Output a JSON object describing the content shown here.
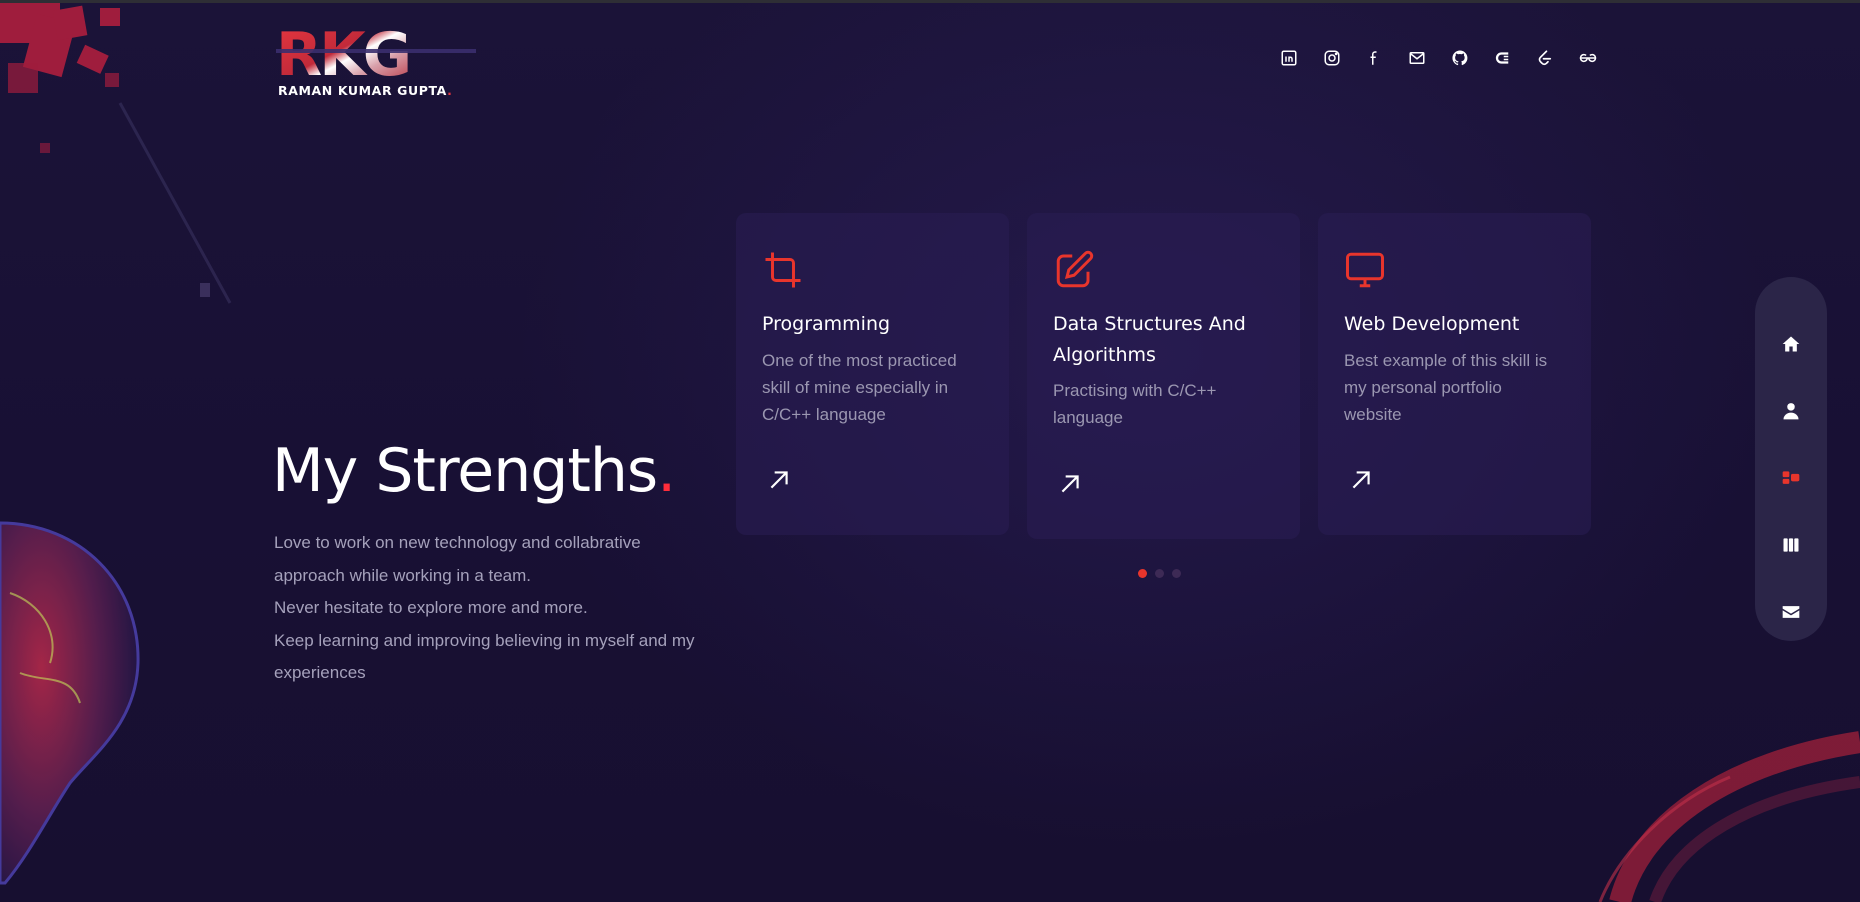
{
  "logo": {
    "mark_text": "RKG",
    "subtitle": "RAMAN KUMAR GUPTA",
    "subtitle_dot": "."
  },
  "social": [
    {
      "name": "linkedin-icon"
    },
    {
      "name": "instagram-icon"
    },
    {
      "name": "facebook-icon"
    },
    {
      "name": "mail-icon"
    },
    {
      "name": "github-icon"
    },
    {
      "name": "codechef-icon"
    },
    {
      "name": "leetcode-icon"
    },
    {
      "name": "geeksforgeeks-icon"
    }
  ],
  "hero": {
    "heading": "My Strengths",
    "heading_dot": ".",
    "lines": [
      "Love to work on new technology and collabrative approach while working in a team.",
      "Never hesitate to explore more and more.",
      "Keep learning and improving believing in myself and my experiences"
    ]
  },
  "cards": [
    {
      "icon": "crop-icon",
      "title": "Programming",
      "description": "One of the most practiced skill of mine especially in C/C++ language"
    },
    {
      "icon": "edit-icon",
      "title": "Data Structures And Algorithms",
      "description": "Practising with C/C++ language"
    },
    {
      "icon": "monitor-icon",
      "title": "Web Development",
      "description": "Best example of this skill is my personal portfolio website"
    }
  ],
  "carousel": {
    "active_index": 0,
    "count": 3
  },
  "sidenav": [
    {
      "icon": "home-icon",
      "active": false
    },
    {
      "icon": "user-icon",
      "active": false
    },
    {
      "icon": "services-icon",
      "active": true
    },
    {
      "icon": "columns-icon",
      "active": false
    },
    {
      "icon": "envelope-icon",
      "active": false
    }
  ],
  "colors": {
    "accent": "#e8352c",
    "background": "#17102e",
    "card": "#241a4a",
    "nav": "#2b2548"
  }
}
